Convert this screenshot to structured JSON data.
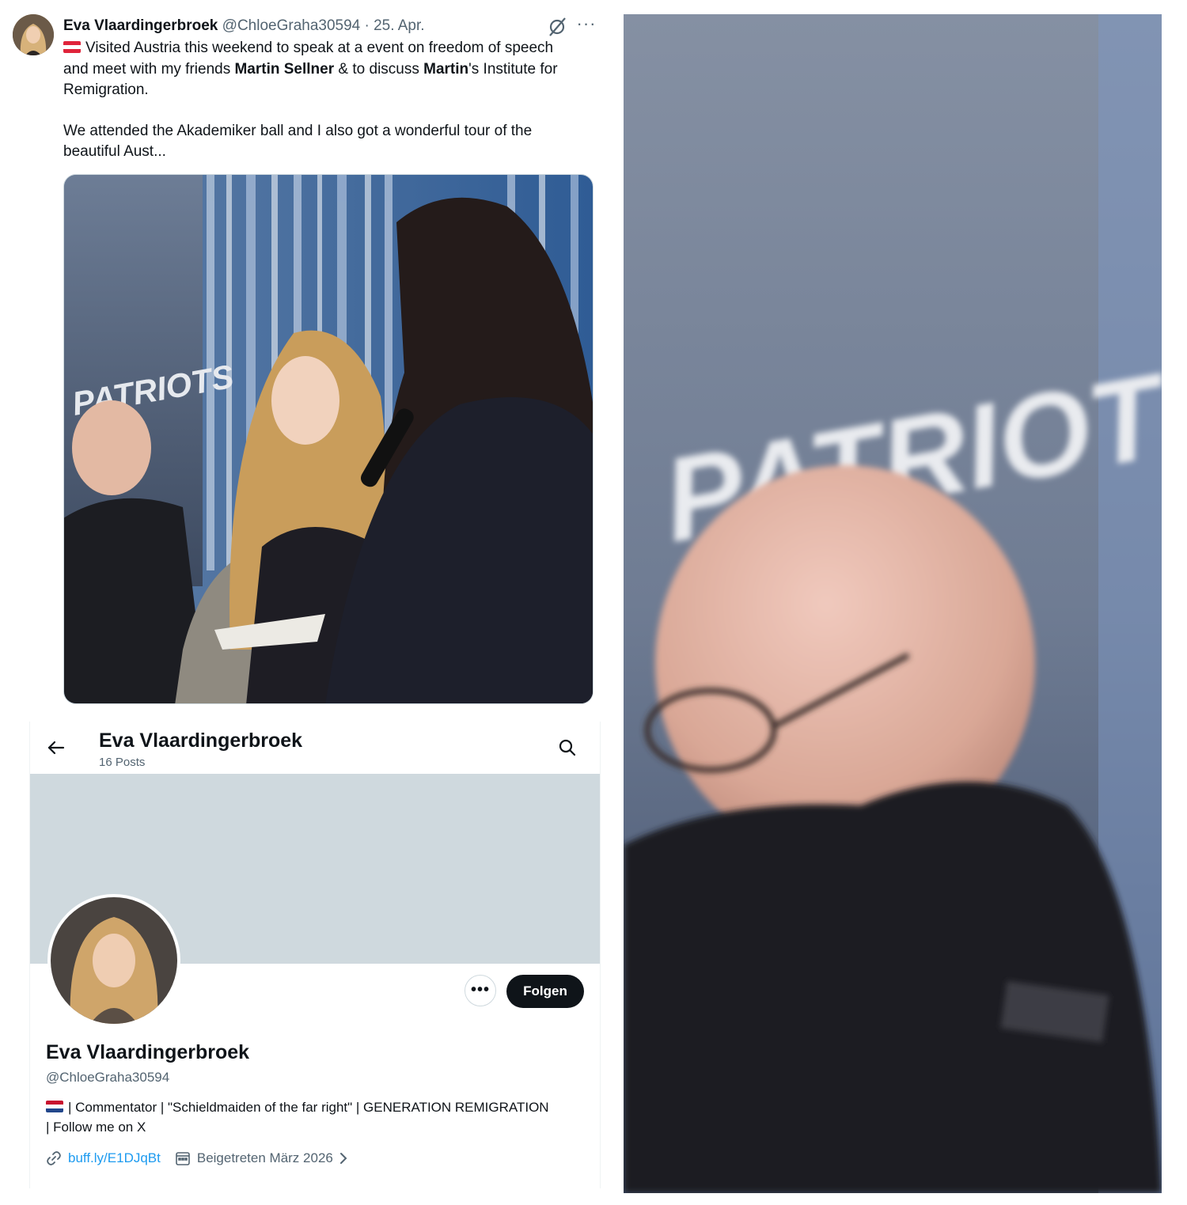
{
  "tweet": {
    "author_name": "Eva Vlaardingerbroek",
    "author_handle": "@ChloeGraha30594",
    "date": " · 25. Apr.",
    "line1": "Visited Austria this weekend to speak at a  event on freedom of speech",
    "line2_pre": "and meet with my friends ",
    "line2_bold1": "Martin Sellner",
    "line2_mid": " &  to discuss ",
    "line2_bold2": "Martin",
    "line2_post": "'s Institute for",
    "line3": "Remigration.",
    "line4": "We attended the Akademiker ball and I also got a wonderful tour of the",
    "line5": "beautiful Aust...",
    "photo_banner_text": "PATRIOTS",
    "flag_icon": "austria-flag-icon"
  },
  "profile": {
    "header_title": "Eva Vlaardingerbroek",
    "post_count": "16 Posts",
    "display_name": "Eva Vlaardingerbroek",
    "handle": "@ChloeGraha30594",
    "bio_line1": "| Commentator | \"Schieldmaiden of the far right\" | GENERATION REMIGRATION",
    "bio_line2": "| Follow me on X",
    "link": "buff.ly/E1DJqBt",
    "joined": "Beigetreten März 2026",
    "follow_label": "Folgen",
    "more_label": "•••",
    "banner_color": "#cfd9de"
  },
  "zoom": {
    "banner_text": "PATRIOTS"
  },
  "colors": {
    "accent": "#1d9bf0",
    "text": "#0f1419",
    "muted": "#536471",
    "button": "#0f1419"
  }
}
